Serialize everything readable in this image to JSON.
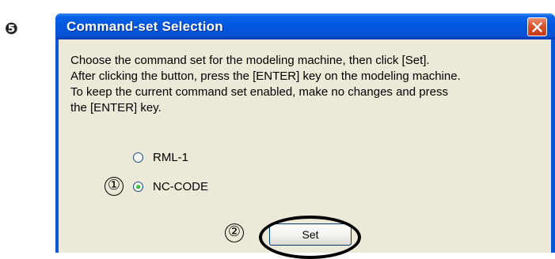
{
  "step_badge": "❺",
  "window": {
    "title": "Command-set Selection",
    "close_icon": "close-x-icon"
  },
  "message": [
    "Choose the command set for the modeling machine, then click [Set].",
    "After clicking the button, press the [ENTER] key on the modeling machine.",
    "To keep the current command set enabled, make no changes and press",
    "the [ENTER] key."
  ],
  "options": [
    {
      "label": "RML-1",
      "checked": false
    },
    {
      "label": "NC-CODE",
      "checked": true
    }
  ],
  "set_button": {
    "label": "Set"
  },
  "annotations": {
    "marker_1": "①",
    "marker_2": "②"
  },
  "colors": {
    "titlebar": "#0055dd",
    "close_button": "#d9532f",
    "client_bg": "#ece9d8"
  }
}
